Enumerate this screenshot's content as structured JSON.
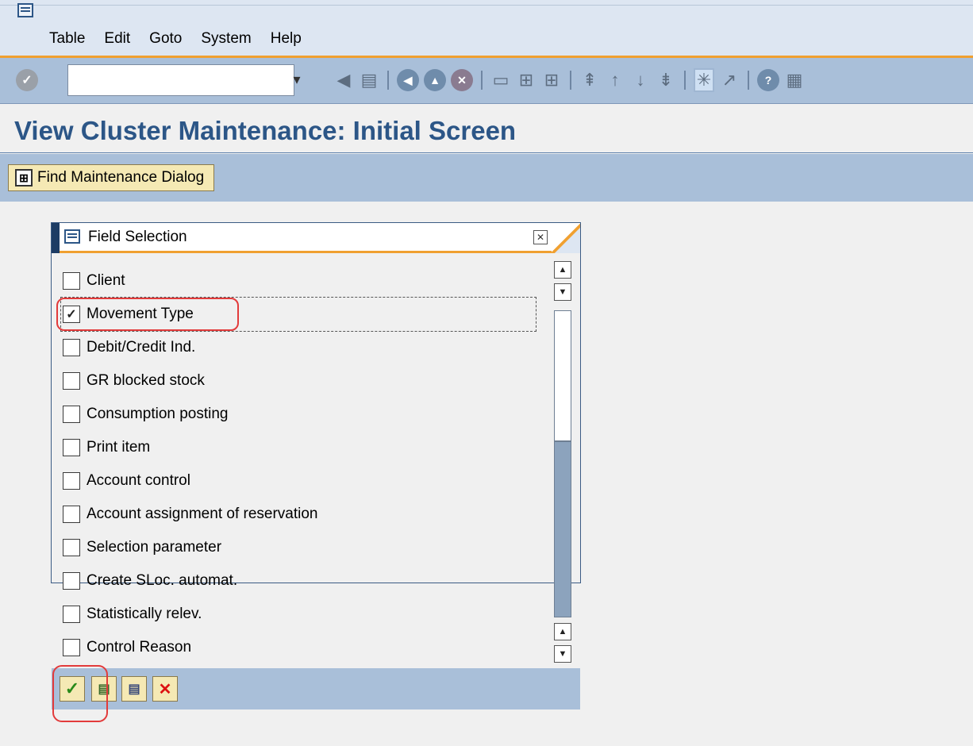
{
  "menubar": {
    "items": [
      "Table",
      "Edit",
      "Goto",
      "System",
      "Help"
    ]
  },
  "toolbar": {
    "command_field_value": "",
    "icons": [
      "enter-icon",
      "back-icon",
      "save-icon",
      "back-nav-icon",
      "exit-icon",
      "cancel-icon",
      "print-icon",
      "find-icon",
      "find-next-icon",
      "first-page-icon",
      "prev-page-icon",
      "next-page-icon",
      "last-page-icon",
      "create-session-icon",
      "shortcut-icon",
      "help-icon",
      "layout-icon"
    ]
  },
  "page": {
    "title": "View Cluster Maintenance: Initial Screen"
  },
  "app_toolbar": {
    "find_button_label": "Find Maintenance Dialog"
  },
  "dialog": {
    "title": "Field Selection",
    "fields": [
      {
        "label": "Client",
        "checked": false
      },
      {
        "label": "Movement Type",
        "checked": true
      },
      {
        "label": "Debit/Credit Ind.",
        "checked": false
      },
      {
        "label": "GR blocked stock",
        "checked": false
      },
      {
        "label": "Consumption posting",
        "checked": false
      },
      {
        "label": "Print item",
        "checked": false
      },
      {
        "label": "Account control",
        "checked": false
      },
      {
        "label": "Account assignment of reservation",
        "checked": false
      },
      {
        "label": "Selection parameter",
        "checked": false
      },
      {
        "label": "Create SLoc. automat.",
        "checked": false
      },
      {
        "label": "Statistically relev.",
        "checked": false
      },
      {
        "label": "Control Reason",
        "checked": false
      }
    ],
    "footer_buttons": [
      "continue-button",
      "select-all-button",
      "deselect-all-button",
      "cancel-button"
    ]
  },
  "colors": {
    "title_blue": "#2c5687",
    "toolbar_blue": "#a9bfd9",
    "accent_orange": "#f0a030",
    "highlight_red": "#e23b3b"
  }
}
